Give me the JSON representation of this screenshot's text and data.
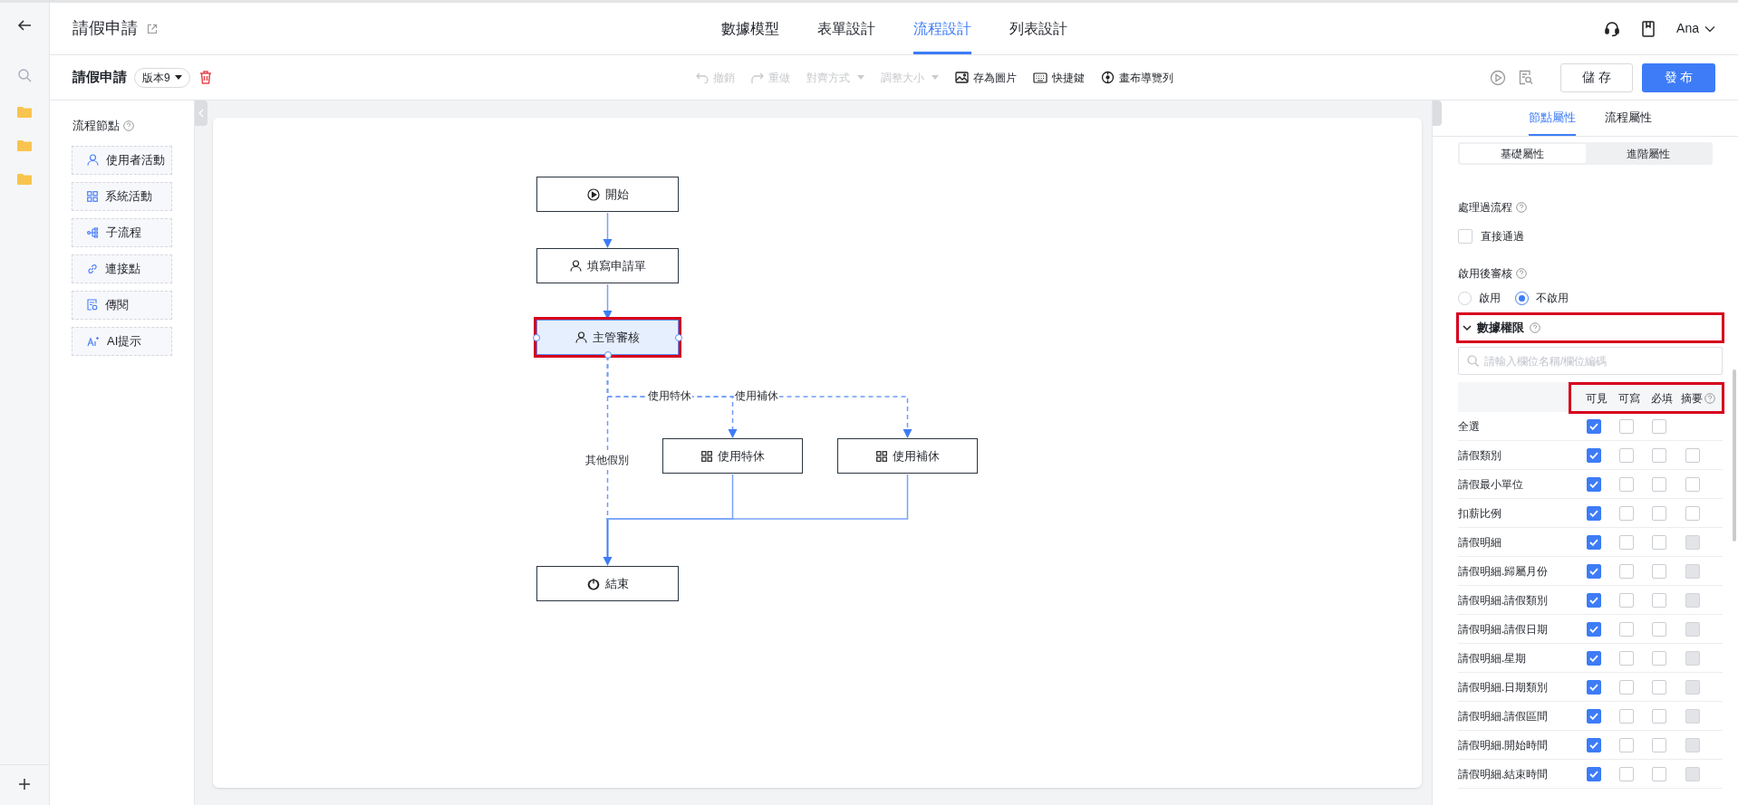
{
  "app": {
    "title": "請假申請",
    "tabs": [
      {
        "label": "數據模型",
        "selected": false
      },
      {
        "label": "表單設計",
        "selected": false
      },
      {
        "label": "流程設計",
        "selected": true
      },
      {
        "label": "列表設計",
        "selected": false
      }
    ],
    "user": "Ana"
  },
  "toolbar": {
    "title": "請假申請",
    "version": "版本9",
    "tools": [
      {
        "kind": "undo",
        "label": "撤銷",
        "disabled": true,
        "dropdown": false
      },
      {
        "kind": "redo",
        "label": "重做",
        "disabled": true,
        "dropdown": false
      },
      {
        "kind": "align",
        "label": "對齊方式",
        "disabled": true,
        "dropdown": true
      },
      {
        "kind": "resize",
        "label": "調整大小",
        "disabled": true,
        "dropdown": true
      },
      {
        "kind": "image",
        "label": "存為圖片",
        "disabled": false,
        "dropdown": false
      },
      {
        "kind": "keyboard",
        "label": "快捷鍵",
        "disabled": false,
        "dropdown": false
      },
      {
        "kind": "navigator",
        "label": "畫布導覽列",
        "disabled": false,
        "dropdown": false
      }
    ],
    "save": "儲 存",
    "publish": "發 布"
  },
  "node_palette": {
    "title": "流程節點",
    "items": [
      {
        "kind": "user",
        "label": "使用者活動"
      },
      {
        "kind": "system",
        "label": "系統活動"
      },
      {
        "kind": "subflow",
        "label": "子流程"
      },
      {
        "kind": "link",
        "label": "連接點"
      },
      {
        "kind": "cc",
        "label": "傳閱"
      },
      {
        "kind": "ai",
        "label": "AI提示"
      }
    ]
  },
  "flow": {
    "nodes": [
      {
        "kind": "start",
        "label": "開始",
        "selected": false,
        "highlighted": false
      },
      {
        "kind": "user",
        "label": "填寫申請單",
        "selected": false,
        "highlighted": false
      },
      {
        "kind": "user",
        "label": "主管審核",
        "selected": true,
        "highlighted": true
      },
      {
        "kind": "system",
        "label": "使用特休",
        "selected": false,
        "highlighted": false
      },
      {
        "kind": "system",
        "label": "使用補休",
        "selected": false,
        "highlighted": false
      },
      {
        "kind": "end",
        "label": "結束",
        "selected": false,
        "highlighted": false
      }
    ],
    "edges": [
      {
        "dashed": false
      },
      {
        "dashed": false
      },
      {
        "dashed": true,
        "label": "使用特休"
      },
      {
        "dashed": true,
        "label": "使用補休"
      },
      {
        "dashed": true,
        "label": "其他假別"
      },
      {
        "dashed": false
      },
      {
        "dashed": false
      }
    ]
  },
  "properties": {
    "tabs": [
      {
        "label": "節點屬性",
        "selected": true
      },
      {
        "label": "流程屬性",
        "selected": false
      }
    ],
    "subtabs": [
      {
        "label": "基礎屬性",
        "selected": true
      },
      {
        "label": "進階屬性",
        "selected": false
      }
    ],
    "processed_flow": {
      "label": "處理過流程",
      "option": "直接通過",
      "checked": false
    },
    "post_review": {
      "label": "啟用後審核",
      "options": [
        {
          "label": "啟用",
          "selected": false
        },
        {
          "label": "不啟用",
          "selected": true
        }
      ]
    },
    "data_permissions": {
      "title": "數據權限",
      "expanded": true,
      "highlighted": true,
      "search_placeholder": "請輸入欄位名稱/欄位編碼",
      "columns": [
        "可見",
        "可寫",
        "必填",
        "摘要"
      ],
      "columns_highlighted": true,
      "rows": [
        {
          "kind": "all",
          "label": "全選",
          "visible": true,
          "writable": false,
          "required": false
        },
        {
          "kind": "field",
          "label": "請假類別",
          "visible": true,
          "writable": false,
          "required": false,
          "summary": false,
          "summary_disabled": false
        },
        {
          "kind": "field",
          "label": "請假最小單位",
          "visible": true,
          "writable": false,
          "required": false,
          "summary": false,
          "summary_disabled": false
        },
        {
          "kind": "field",
          "label": "扣薪比例",
          "visible": true,
          "writable": false,
          "required": false,
          "summary": false,
          "summary_disabled": false
        },
        {
          "kind": "field",
          "label": "請假明細",
          "visible": true,
          "writable": false,
          "required": false,
          "summary": false,
          "summary_disabled": true
        },
        {
          "kind": "field",
          "label": "請假明細.歸屬月份",
          "visible": true,
          "writable": false,
          "required": false,
          "summary": false,
          "summary_disabled": true
        },
        {
          "kind": "field",
          "label": "請假明細.請假類別",
          "visible": true,
          "writable": false,
          "required": false,
          "summary": false,
          "summary_disabled": true
        },
        {
          "kind": "field",
          "label": "請假明細.請假日期",
          "visible": true,
          "writable": false,
          "required": false,
          "summary": false,
          "summary_disabled": true
        },
        {
          "kind": "field",
          "label": "請假明細.星期",
          "visible": true,
          "writable": false,
          "required": false,
          "summary": false,
          "summary_disabled": true
        },
        {
          "kind": "field",
          "label": "請假明細.日期類別",
          "visible": true,
          "writable": false,
          "required": false,
          "summary": false,
          "summary_disabled": true
        },
        {
          "kind": "field",
          "label": "請假明細.請假區間",
          "visible": true,
          "writable": false,
          "required": false,
          "summary": false,
          "summary_disabled": true
        },
        {
          "kind": "field",
          "label": "請假明細.開始時間",
          "visible": true,
          "writable": false,
          "required": false,
          "summary": false,
          "summary_disabled": true
        },
        {
          "kind": "field",
          "label": "請假明細.結束時間",
          "visible": true,
          "writable": false,
          "required": false,
          "summary": false,
          "summary_disabled": true
        }
      ]
    }
  }
}
